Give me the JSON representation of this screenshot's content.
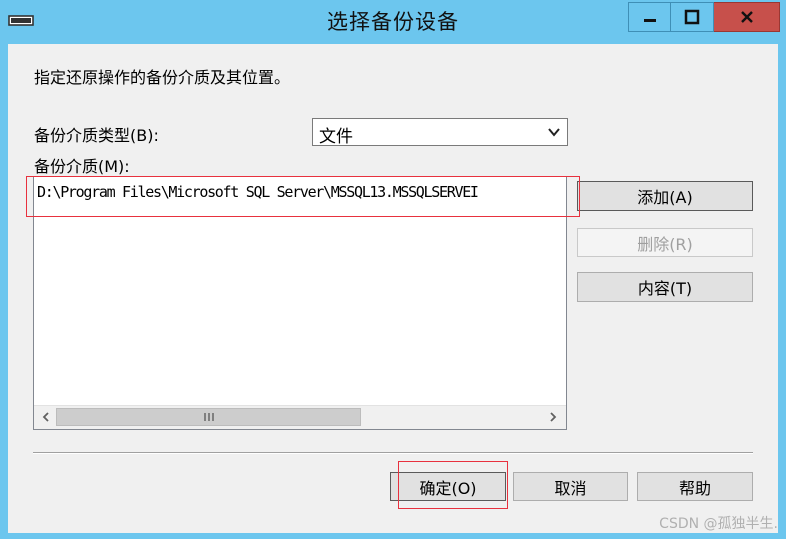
{
  "window": {
    "title": "选择备份设备",
    "controls": {
      "minimize": "minimize",
      "maximize": "maximize",
      "close": "close"
    }
  },
  "instruction": "指定还原操作的备份介质及其位置。",
  "media_type": {
    "label": "备份介质类型(B):",
    "value": "文件"
  },
  "media_list": {
    "label": "备份介质(M):",
    "items": [
      "D:\\Program Files\\Microsoft SQL Server\\MSSQL13.MSSQLSERVEI"
    ]
  },
  "side_buttons": {
    "add": "添加(A)",
    "remove": "删除(R)",
    "contents": "内容(T)"
  },
  "footer_buttons": {
    "ok": "确定(O)",
    "cancel": "取消",
    "help": "帮助"
  },
  "watermark": "CSDN @孤独半生."
}
